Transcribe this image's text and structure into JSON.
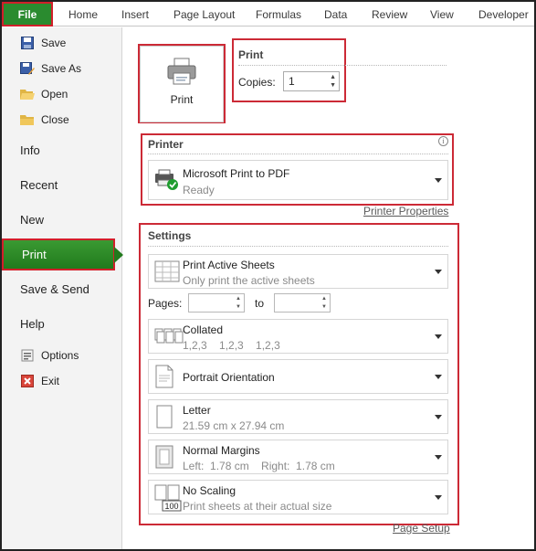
{
  "ribbon": {
    "file_label": "File",
    "tabs": [
      "Home",
      "Insert",
      "Page Layout",
      "Formulas",
      "Data",
      "Review",
      "View",
      "Developer"
    ]
  },
  "nav": {
    "small_top": [
      {
        "label": "Save",
        "icon": "save-icon"
      },
      {
        "label": "Save As",
        "icon": "save-as-icon"
      },
      {
        "label": "Open",
        "icon": "folder-open-icon"
      },
      {
        "label": "Close",
        "icon": "folder-close-icon"
      }
    ],
    "info": "Info",
    "recent": "Recent",
    "new": "New",
    "print": "Print",
    "save_send": "Save & Send",
    "help": "Help",
    "options": "Options",
    "exit": "Exit"
  },
  "print": {
    "button_label": "Print",
    "section_title": "Print",
    "copies_label": "Copies:",
    "copies_value": "1"
  },
  "printer": {
    "section_title": "Printer",
    "name": "Microsoft Print to PDF",
    "status": "Ready",
    "properties_link": "Printer Properties"
  },
  "settings": {
    "section_title": "Settings",
    "sheets": {
      "title": "Print Active Sheets",
      "sub": "Only print the active sheets"
    },
    "pages_label": "Pages:",
    "to_label": "to",
    "collated": {
      "title": "Collated",
      "sub": "1,2,3    1,2,3    1,2,3"
    },
    "orientation": {
      "title": "Portrait Orientation"
    },
    "paper": {
      "title": "Letter",
      "sub": "21.59 cm x 27.94 cm"
    },
    "margins": {
      "title": "Normal Margins",
      "sub": "Left:  1.78 cm    Right:  1.78 cm"
    },
    "scaling": {
      "title": "No Scaling",
      "sub": "Print sheets at their actual size",
      "icon_text": "100"
    },
    "page_setup_link": "Page Setup"
  },
  "colors": {
    "file_green": "#2a8b2f",
    "highlight_red": "#cc2a36",
    "status_green": "#1f9d2f"
  }
}
